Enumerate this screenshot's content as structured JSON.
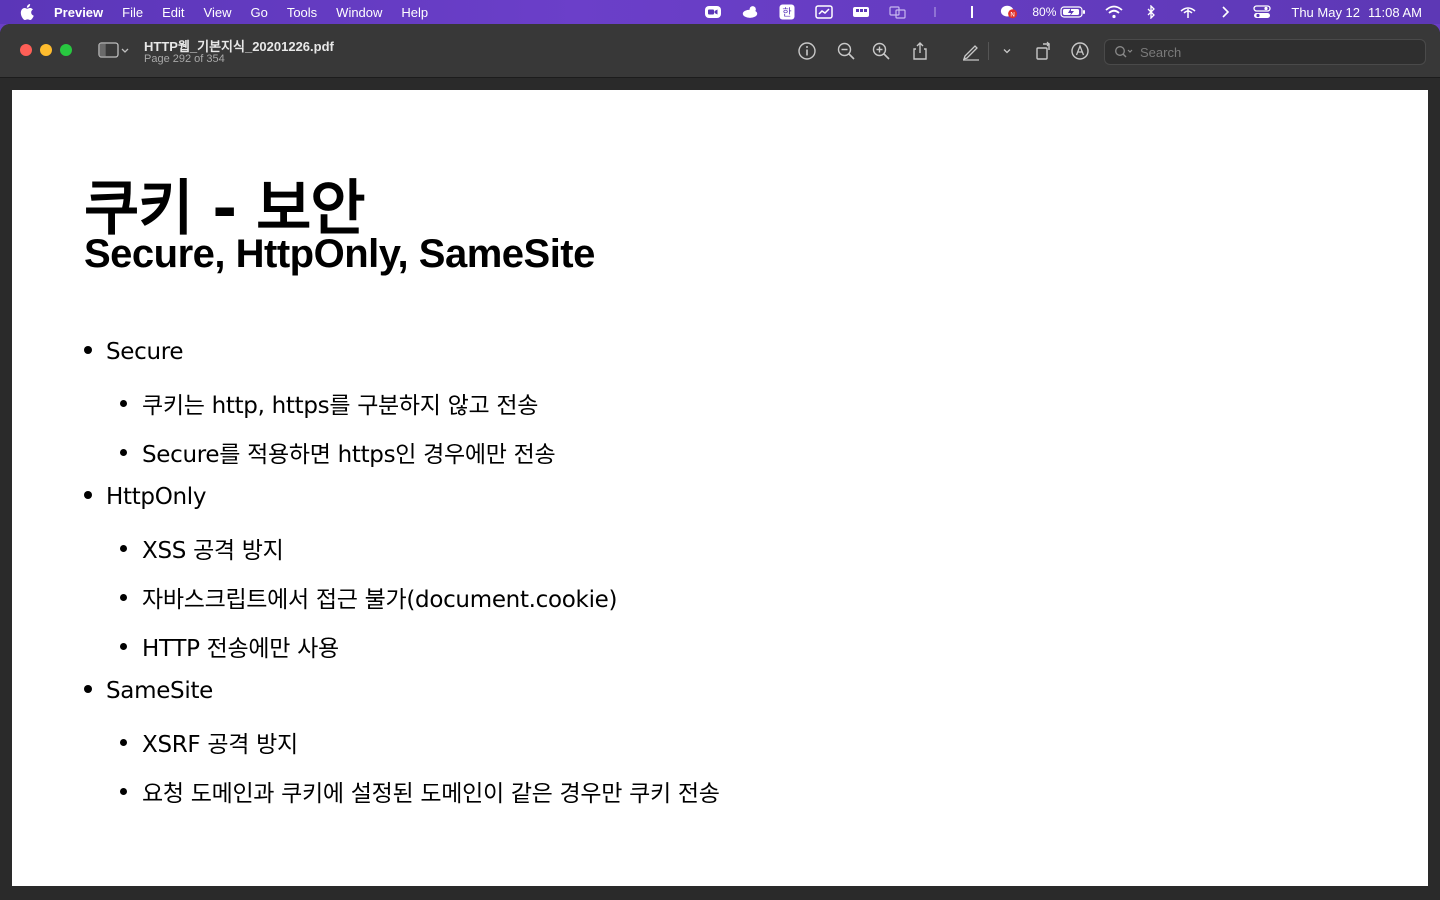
{
  "menubar": {
    "app_name": "Preview",
    "items": [
      "File",
      "Edit",
      "View",
      "Go",
      "Tools",
      "Window",
      "Help"
    ],
    "battery_percent": "80%",
    "date": "Thu May 12",
    "time": "11:08 AM"
  },
  "window": {
    "doc_title": "HTTP웹_기본지식_20201226.pdf",
    "page_info": "Page 292 of 354",
    "search_placeholder": "Search"
  },
  "slide": {
    "title": "쿠키 - 보안",
    "subtitle": "Secure, HttpOnly, SameSite",
    "bullets": [
      {
        "text": "Secure",
        "children": [
          "쿠키는 http, https를 구분하지 않고 전송",
          "Secure를 적용하면 https인 경우에만 전송"
        ]
      },
      {
        "text": "HttpOnly",
        "children": [
          "XSS 공격 방지",
          "자바스크립트에서 접근 불가(document.cookie)",
          "HTTP 전송에만 사용"
        ]
      },
      {
        "text": "SameSite",
        "children": [
          "XSRF 공격 방지",
          "요청 도메인과 쿠키에 설정된 도메인이 같은 경우만 쿠키 전송"
        ]
      }
    ]
  },
  "colors": {
    "menubar": "#6b3fc9",
    "toolbar": "#383838",
    "close": "#fe5f57",
    "minimize": "#febc2e",
    "maximize": "#28c840"
  }
}
